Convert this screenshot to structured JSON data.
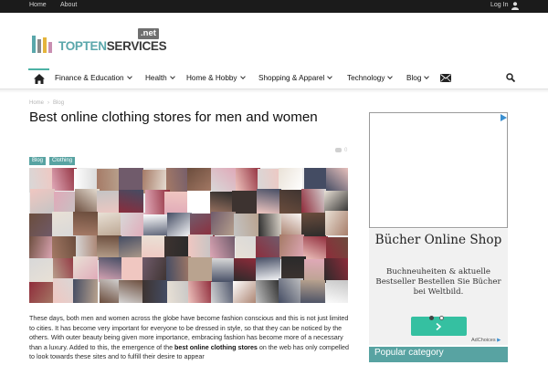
{
  "topbar": {
    "home": "Home",
    "about": "About",
    "login": "Log In"
  },
  "logo": {
    "part1": "TOPTEN",
    "part2": "SERVICES",
    "tld": ".net"
  },
  "nav": [
    {
      "label": "Finance & Education"
    },
    {
      "label": "Health"
    },
    {
      "label": "Home & Hobby"
    },
    {
      "label": "Shopping & Apparel"
    },
    {
      "label": "Technology"
    },
    {
      "label": "Blog"
    }
  ],
  "breadcrumb": {
    "home": "Home",
    "blog": "Blog"
  },
  "article": {
    "title": "Best online clothing stores for men and women",
    "tags": [
      "Blog",
      "Clothing"
    ],
    "comments": "0",
    "body_1": "These days, both men and women across the globe have become fashion conscious and this is not just limited to cities. It has become very important for everyone to be dressed in style, so that they can be noticed by the others. With outer beauty being given more importance, embracing fashion has become more of a necessary than a luxury. Added to this, the emergence of the ",
    "body_bold": "best online clothing stores",
    "body_2": " on the web has only compelled to look towards these sites and to fulfill their desire to appear"
  },
  "ad": {
    "title": "Bücher Online Shop",
    "subtitle": "Buchneuheiten & aktuelle Bestseller Bestellen Sie Bücher bei Weltbild.",
    "adchoices": "AdChoices",
    "button_color": "#35c0a1"
  },
  "sidebar": {
    "popular_category": "Popular category"
  },
  "colors": {
    "accent": "#58a3a2",
    "topbar": "#1b1b1b"
  }
}
